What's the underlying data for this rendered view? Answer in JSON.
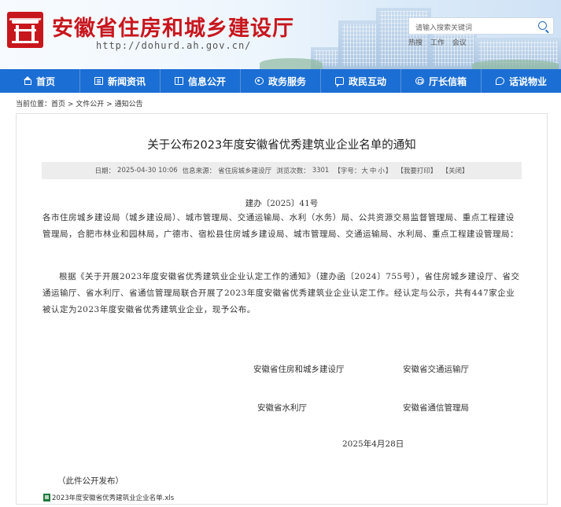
{
  "header": {
    "site_title": "安徽省住房和城乡建设厅",
    "site_url": "http://dohurd.ah.gov.cn/",
    "search_placeholder": "请输入搜索关键词",
    "hot_words": [
      "热搜",
      "工作",
      "会议"
    ]
  },
  "nav": {
    "items": [
      {
        "label": "首页",
        "icon": "home-icon"
      },
      {
        "label": "新闻资讯",
        "icon": "news-icon"
      },
      {
        "label": "信息公开",
        "icon": "book-icon"
      },
      {
        "label": "政务服务",
        "icon": "service-icon"
      },
      {
        "label": "政民互动",
        "icon": "chat-icon"
      },
      {
        "label": "厅长信箱",
        "icon": "mail-icon"
      },
      {
        "label": "话说物业",
        "icon": "talk-icon"
      }
    ]
  },
  "breadcrumb": {
    "prefix": "当前位置：",
    "items": [
      "首页",
      "文件公开",
      "通知公告"
    ],
    "separator": " > "
  },
  "article": {
    "title": "关于公布2023年度安徽省优秀建筑业企业名单的通知",
    "meta": {
      "date_label": "日期：",
      "date": "2025-04-30 10:06",
      "source_label": "信息来源：",
      "source": "省住房城乡建设厅",
      "views_label": "浏览次数：",
      "views": "3301",
      "font_label": "【字号：",
      "font_large": "大",
      "font_medium": "中",
      "font_small": "小",
      "font_end": "】",
      "print": "【我要打印】",
      "close": "【关闭】"
    },
    "doc_number": "建办〔2025〕41号",
    "recipients": "各市住房城乡建设局（城乡建设局）、城市管理局、交通运输局、水利（水务）局、公共资源交易监督管理局、重点工程建设管理局，合肥市林业和园林局，广德市、宿松县住房城乡建设局、城市管理局、交通运输局、水利局、重点工程建设管理局：",
    "body": "根据《关于开展2023年度安徽省优秀建筑业企业认定工作的通知》（建办函〔2024〕755号），省住房城乡建设厅、省交通运输厅、省水利厅、省通信管理局联合开展了2023年度安徽省优秀建筑业企业认定工作。经认定与公示，共有447家企业被认定为2023年度安徽省优秀建筑业企业，现予公布。",
    "signatories": [
      "安徽省住房和城乡建设厅",
      "安徽省交通运输厅",
      "安徽省水利厅",
      "安徽省通信管理局"
    ],
    "sign_date": "2025年4月28日",
    "note": "（此件公开发布）",
    "attachment": "2023年度安徽省优秀建筑业企业名单.xls"
  }
}
